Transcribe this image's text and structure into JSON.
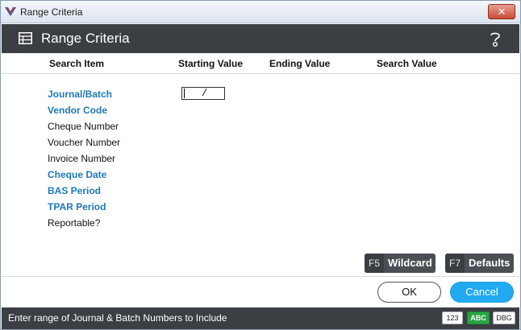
{
  "window": {
    "title": "Range Criteria",
    "close_label": "✕"
  },
  "header": {
    "title": "Range Criteria",
    "help_icon": "help-question-icon"
  },
  "columns": {
    "search_item": "Search Item",
    "starting_value": "Starting Value",
    "ending_value": "Ending Value",
    "search_value": "Search Value"
  },
  "items": [
    {
      "label": "Journal/Batch",
      "style": "link"
    },
    {
      "label": "Vendor Code",
      "style": "link"
    },
    {
      "label": "Cheque Number",
      "style": "plain"
    },
    {
      "label": "Voucher Number",
      "style": "plain"
    },
    {
      "label": "Invoice Number",
      "style": "plain"
    },
    {
      "label": "Cheque Date",
      "style": "link"
    },
    {
      "label": "BAS Period",
      "style": "link"
    },
    {
      "label": "TPAR Period",
      "style": "link"
    },
    {
      "label": "Reportable?",
      "style": "plain"
    }
  ],
  "batch_input": {
    "separator": "/"
  },
  "fkeys": {
    "wildcard": {
      "key": "F5",
      "label": "Wildcard"
    },
    "defaults": {
      "key": "F7",
      "label": "Defaults"
    }
  },
  "buttons": {
    "ok": "OK",
    "cancel": "Cancel"
  },
  "status": {
    "message": "Enter range of Journal & Batch Numbers to Include",
    "badge_numeric": "123",
    "badge_alpha": "ABC",
    "badge_debug": "DBG"
  },
  "colors": {
    "header_bg": "#3b3f44",
    "link": "#1e78b7",
    "accent": "#22aaf0",
    "abc_badge": "#29a443"
  }
}
